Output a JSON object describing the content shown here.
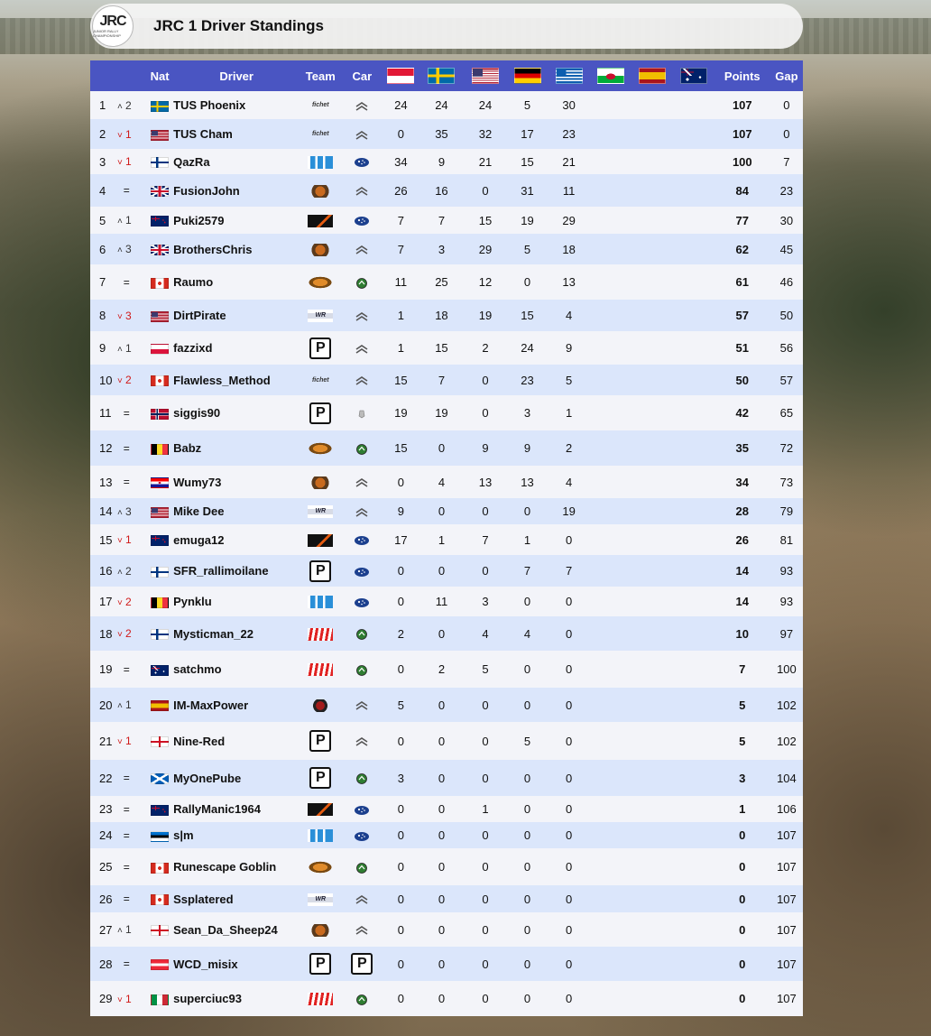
{
  "title": "JRC 1 Driver Standings",
  "logo": {
    "main": "JRC",
    "sub": "JUNIOR RALLY CHAMPIONSHIP"
  },
  "headers": {
    "pos": "",
    "chg": "",
    "nat": "Nat",
    "driver": "Driver",
    "team": "Team",
    "car": "Car",
    "points": "Points",
    "gap": "Gap"
  },
  "rally_flags": [
    "monaco",
    "sweden",
    "usa",
    "germany",
    "greece",
    "wales",
    "spain",
    "australia"
  ],
  "rows": [
    {
      "pos": "1",
      "dir": "up",
      "chg": "2",
      "nat": "sweden",
      "driver": "TUS Phoenix",
      "team": "fichet",
      "car": "citroen",
      "r": [
        "24",
        "24",
        "24",
        "5",
        "30",
        "",
        "",
        ""
      ],
      "points": "107",
      "gap": "0"
    },
    {
      "pos": "2",
      "dir": "down",
      "chg": "1",
      "nat": "usa",
      "driver": "TUS Cham",
      "team": "fichet",
      "car": "citroen",
      "r": [
        "0",
        "35",
        "32",
        "17",
        "23",
        "",
        "",
        ""
      ],
      "points": "107",
      "gap": "0"
    },
    {
      "pos": "3",
      "dir": "down",
      "chg": "1",
      "nat": "finland",
      "driver": "QazRa",
      "team": "blue",
      "car": "subaru",
      "r": [
        "34",
        "9",
        "21",
        "15",
        "21",
        "",
        "",
        ""
      ],
      "points": "100",
      "gap": "7"
    },
    {
      "pos": "4",
      "dir": "eq",
      "chg": "",
      "nat": "uk",
      "driver": "FusionJohn",
      "team": "badge",
      "car": "citroen",
      "r": [
        "26",
        "16",
        "0",
        "31",
        "11",
        "",
        "",
        ""
      ],
      "points": "84",
      "gap": "23"
    },
    {
      "pos": "5",
      "dir": "up",
      "chg": "1",
      "nat": "newzealand",
      "driver": "Puki2579",
      "team": "dark",
      "car": "subaru",
      "r": [
        "7",
        "7",
        "15",
        "19",
        "29",
        "",
        "",
        ""
      ],
      "points": "77",
      "gap": "30"
    },
    {
      "pos": "6",
      "dir": "up",
      "chg": "3",
      "nat": "uk",
      "driver": "BrothersChris",
      "team": "badge",
      "car": "citroen",
      "r": [
        "7",
        "3",
        "29",
        "5",
        "18",
        "",
        "",
        ""
      ],
      "points": "62",
      "gap": "45"
    },
    {
      "pos": "7",
      "dir": "eq",
      "chg": "",
      "nat": "canada",
      "driver": "Raumo",
      "team": "orange",
      "car": "skoda",
      "r": [
        "11",
        "25",
        "12",
        "0",
        "13",
        "",
        "",
        ""
      ],
      "points": "61",
      "gap": "46"
    },
    {
      "pos": "8",
      "dir": "down",
      "chg": "3",
      "nat": "usa",
      "driver": "DirtPirate",
      "team": "wr",
      "car": "citroen",
      "r": [
        "1",
        "18",
        "19",
        "15",
        "4",
        "",
        "",
        ""
      ],
      "points": "57",
      "gap": "50"
    },
    {
      "pos": "9",
      "dir": "up",
      "chg": "1",
      "nat": "poland",
      "driver": "fazzixd",
      "team": "p",
      "car": "citroen",
      "r": [
        "1",
        "15",
        "2",
        "24",
        "9",
        "",
        "",
        ""
      ],
      "points": "51",
      "gap": "56"
    },
    {
      "pos": "10",
      "dir": "down",
      "chg": "2",
      "nat": "canada",
      "driver": "Flawless_Method",
      "team": "fichet",
      "car": "citroen",
      "r": [
        "15",
        "7",
        "0",
        "23",
        "5",
        "",
        "",
        ""
      ],
      "points": "50",
      "gap": "57"
    },
    {
      "pos": "11",
      "dir": "eq",
      "chg": "",
      "nat": "norway",
      "driver": "siggis90",
      "team": "p",
      "car": "peugeot",
      "r": [
        "19",
        "19",
        "0",
        "3",
        "1",
        "",
        "",
        ""
      ],
      "points": "42",
      "gap": "65"
    },
    {
      "pos": "12",
      "dir": "eq",
      "chg": "",
      "nat": "belgium",
      "driver": "Babz",
      "team": "orange",
      "car": "skoda",
      "r": [
        "15",
        "0",
        "9",
        "9",
        "2",
        "",
        "",
        ""
      ],
      "points": "35",
      "gap": "72"
    },
    {
      "pos": "13",
      "dir": "eq",
      "chg": "",
      "nat": "croatia",
      "driver": "Wumy73",
      "team": "badge",
      "car": "citroen",
      "r": [
        "0",
        "4",
        "13",
        "13",
        "4",
        "",
        "",
        ""
      ],
      "points": "34",
      "gap": "73"
    },
    {
      "pos": "14",
      "dir": "up",
      "chg": "3",
      "nat": "usa",
      "driver": "Mike Dee",
      "team": "wr",
      "car": "citroen",
      "r": [
        "9",
        "0",
        "0",
        "0",
        "19",
        "",
        "",
        ""
      ],
      "points": "28",
      "gap": "79"
    },
    {
      "pos": "15",
      "dir": "down",
      "chg": "1",
      "nat": "newzealand",
      "driver": "emuga12",
      "team": "dark",
      "car": "subaru",
      "r": [
        "17",
        "1",
        "7",
        "1",
        "0",
        "",
        "",
        ""
      ],
      "points": "26",
      "gap": "81"
    },
    {
      "pos": "16",
      "dir": "up",
      "chg": "2",
      "nat": "finland",
      "driver": "SFR_rallimoilane",
      "team": "p",
      "car": "subaru",
      "r": [
        "0",
        "0",
        "0",
        "7",
        "7",
        "",
        "",
        ""
      ],
      "points": "14",
      "gap": "93"
    },
    {
      "pos": "17",
      "dir": "down",
      "chg": "2",
      "nat": "belgium",
      "driver": "Pynklu",
      "team": "blue",
      "car": "subaru",
      "r": [
        "0",
        "11",
        "3",
        "0",
        "0",
        "",
        "",
        ""
      ],
      "points": "14",
      "gap": "93"
    },
    {
      "pos": "18",
      "dir": "down",
      "chg": "2",
      "nat": "finland",
      "driver": "Mysticman_22",
      "team": "red",
      "car": "skoda",
      "r": [
        "2",
        "0",
        "4",
        "4",
        "0",
        "",
        "",
        ""
      ],
      "points": "10",
      "gap": "97"
    },
    {
      "pos": "19",
      "dir": "eq",
      "chg": "",
      "nat": "australia",
      "driver": "satchmo",
      "team": "red",
      "car": "skoda",
      "r": [
        "0",
        "2",
        "5",
        "0",
        "0",
        "",
        "",
        ""
      ],
      "points": "7",
      "gap": "100"
    },
    {
      "pos": "20",
      "dir": "up",
      "chg": "1",
      "nat": "spain",
      "driver": "IM-MaxPower",
      "team": "crest",
      "car": "citroen",
      "r": [
        "5",
        "0",
        "0",
        "0",
        "0",
        "",
        "",
        ""
      ],
      "points": "5",
      "gap": "102"
    },
    {
      "pos": "21",
      "dir": "down",
      "chg": "1",
      "nat": "england",
      "driver": "Nine-Red",
      "team": "p",
      "car": "citroen",
      "r": [
        "0",
        "0",
        "0",
        "5",
        "0",
        "",
        "",
        ""
      ],
      "points": "5",
      "gap": "102"
    },
    {
      "pos": "22",
      "dir": "eq",
      "chg": "",
      "nat": "scotland",
      "driver": "MyOnePube",
      "team": "p",
      "car": "skoda",
      "r": [
        "3",
        "0",
        "0",
        "0",
        "0",
        "",
        "",
        ""
      ],
      "points": "3",
      "gap": "104"
    },
    {
      "pos": "23",
      "dir": "eq",
      "chg": "",
      "nat": "newzealand",
      "driver": "RallyManic1964",
      "team": "dark",
      "car": "subaru",
      "r": [
        "0",
        "0",
        "1",
        "0",
        "0",
        "",
        "",
        ""
      ],
      "points": "1",
      "gap": "106"
    },
    {
      "pos": "24",
      "dir": "eq",
      "chg": "",
      "nat": "estonia",
      "driver": "s|m",
      "team": "blue",
      "car": "subaru",
      "r": [
        "0",
        "0",
        "0",
        "0",
        "0",
        "",
        "",
        ""
      ],
      "points": "0",
      "gap": "107"
    },
    {
      "pos": "25",
      "dir": "eq",
      "chg": "",
      "nat": "canada",
      "driver": "Runescape Goblin",
      "team": "orange",
      "car": "skoda",
      "r": [
        "0",
        "0",
        "0",
        "0",
        "0",
        "",
        "",
        ""
      ],
      "points": "0",
      "gap": "107"
    },
    {
      "pos": "26",
      "dir": "eq",
      "chg": "",
      "nat": "canada",
      "driver": "Ssplatered",
      "team": "wr",
      "car": "citroen",
      "r": [
        "0",
        "0",
        "0",
        "0",
        "0",
        "",
        "",
        ""
      ],
      "points": "0",
      "gap": "107"
    },
    {
      "pos": "27",
      "dir": "up",
      "chg": "1",
      "nat": "england",
      "driver": "Sean_Da_Sheep24",
      "team": "badge",
      "car": "citroen",
      "r": [
        "0",
        "0",
        "0",
        "0",
        "0",
        "",
        "",
        ""
      ],
      "points": "0",
      "gap": "107"
    },
    {
      "pos": "28",
      "dir": "eq",
      "chg": "",
      "nat": "austria",
      "driver": "WCD_misix",
      "team": "p",
      "car": "p",
      "r": [
        "0",
        "0",
        "0",
        "0",
        "0",
        "",
        "",
        ""
      ],
      "points": "0",
      "gap": "107"
    },
    {
      "pos": "29",
      "dir": "down",
      "chg": "1",
      "nat": "italy",
      "driver": "superciuc93",
      "team": "red",
      "car": "skoda",
      "r": [
        "0",
        "0",
        "0",
        "0",
        "0",
        "",
        "",
        ""
      ],
      "points": "0",
      "gap": "107"
    }
  ],
  "row_heights": [
    31,
    33,
    28,
    36,
    30,
    34,
    39,
    35,
    37,
    34,
    39,
    39,
    36,
    29,
    34,
    35,
    33,
    38,
    41,
    38,
    42,
    40,
    29,
    29,
    41,
    30,
    38,
    38,
    39
  ],
  "colors": {
    "header_bg": "#4a55c2",
    "row_odd": "#f3f4f9",
    "row_even": "#dbe6fb",
    "down": "#d01818"
  }
}
